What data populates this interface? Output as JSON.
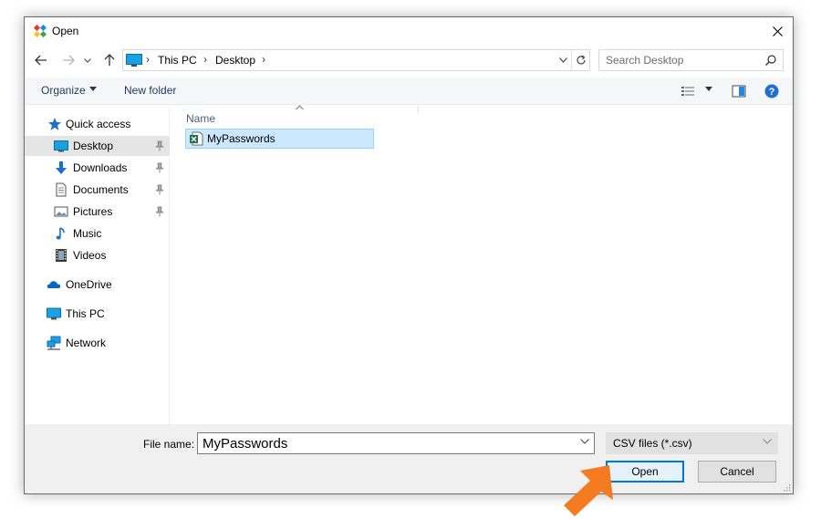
{
  "window": {
    "title": "Open",
    "close_label": "Close"
  },
  "navigation": {
    "back_icon": "arrow-left-icon",
    "forward_icon": "arrow-right-icon",
    "recent_icon": "chevron-down-icon",
    "up_icon": "arrow-up-icon",
    "breadcrumb": [
      "This PC",
      "Desktop"
    ],
    "search_placeholder": "Search Desktop"
  },
  "toolbar": {
    "organize_label": "Organize",
    "new_folder_label": "New folder"
  },
  "sidebar": {
    "items": [
      {
        "label": "Quick access",
        "icon": "star-icon"
      },
      {
        "label": "Desktop",
        "icon": "desktop-icon",
        "pinned": true,
        "selected": true
      },
      {
        "label": "Downloads",
        "icon": "download-icon",
        "pinned": true
      },
      {
        "label": "Documents",
        "icon": "documents-icon",
        "pinned": true
      },
      {
        "label": "Pictures",
        "icon": "pictures-icon",
        "pinned": true
      },
      {
        "label": "Music",
        "icon": "music-note-icon"
      },
      {
        "label": "Videos",
        "icon": "film-icon"
      },
      {
        "label": "OneDrive",
        "icon": "cloud-icon"
      },
      {
        "label": "This PC",
        "icon": "computer-icon"
      },
      {
        "label": "Network",
        "icon": "network-icon"
      }
    ]
  },
  "file_list": {
    "column_header": "Name",
    "files": [
      {
        "name": "MyPasswords",
        "icon": "csv-file-icon",
        "selected": true
      }
    ]
  },
  "footer": {
    "file_name_label": "File name:",
    "file_name_value": "MyPasswords",
    "file_type_value": "CSV files (*.csv)",
    "open_label": "Open",
    "cancel_label": "Cancel"
  },
  "colors": {
    "accent": "#0078d7",
    "selection": "#cce8ff",
    "callout": "#f47b20",
    "help": "#1e6fd2"
  }
}
